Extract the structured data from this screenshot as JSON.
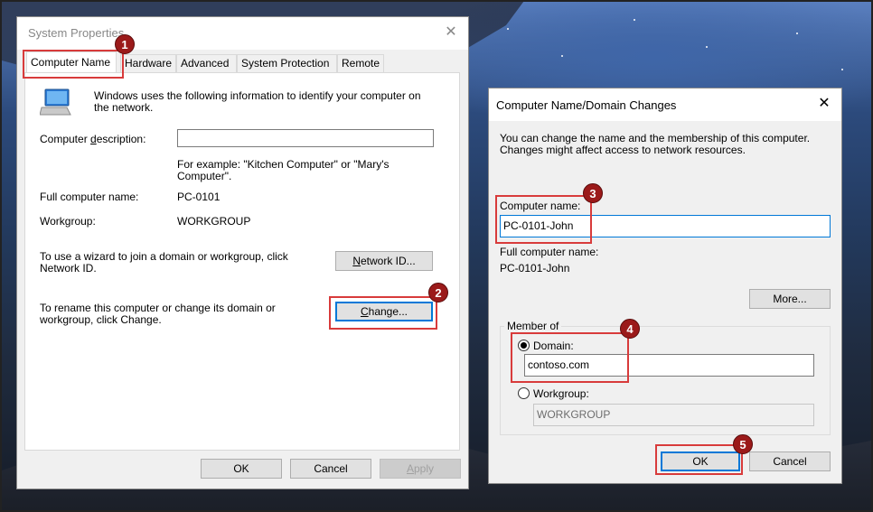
{
  "system_properties": {
    "title": "System Properties",
    "tabs": [
      "Computer Name",
      "Hardware",
      "Advanced",
      "System Protection",
      "Remote"
    ],
    "intro": "Windows uses the following information to identify your computer on the network.",
    "description_label": "Computer description:",
    "description_value": "",
    "example_text": "For example: \"Kitchen Computer\" or \"Mary's Computer\".",
    "full_name_label": "Full computer name:",
    "full_name_value": "PC-0101",
    "workgroup_label": "Workgroup:",
    "workgroup_value": "WORKGROUP",
    "wizard_text": "To use a wizard to join a domain or workgroup, click Network ID.",
    "network_id_button": "Network ID...",
    "rename_text": "To rename this computer or change its domain or workgroup, click Change.",
    "change_button": "Change...",
    "ok_button": "OK",
    "cancel_button": "Cancel",
    "apply_button": "Apply"
  },
  "domain_changes": {
    "title": "Computer Name/Domain Changes",
    "intro": "You can change the name and the membership of this computer. Changes might affect access to network resources.",
    "computer_name_label": "Computer name:",
    "computer_name_value": "PC-0101-John",
    "full_name_label": "Full computer name:",
    "full_name_value": "PC-0101-John",
    "more_button": "More...",
    "member_of_label": "Member of",
    "domain_label": "Domain:",
    "domain_value": "contoso.com",
    "workgroup_label": "Workgroup:",
    "workgroup_value": "WORKGROUP",
    "selected_membership": "Domain",
    "ok_button": "OK",
    "cancel_button": "Cancel"
  },
  "callouts": [
    "1",
    "2",
    "3",
    "4",
    "5"
  ],
  "colors": {
    "callout_fill": "#9b1a1a",
    "highlight_border": "#d83b3b",
    "focus_blue": "#0078d7"
  }
}
